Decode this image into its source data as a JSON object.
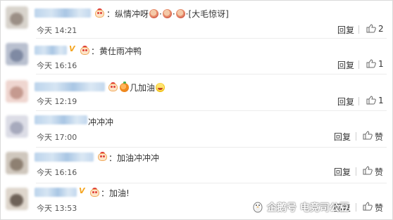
{
  "comments": [
    {
      "content": "：纵情冲呀",
      "emoji_after": [
        "duck",
        "duck",
        "duck"
      ],
      "tail": "[大毛惊讶]",
      "time": "今天 14:21",
      "reply": "回复",
      "like": "2"
    },
    {
      "content": "：黄仕雨冲鸭",
      "vip": "V",
      "time": "今天 16:16",
      "reply": "回复",
      "like": "1"
    },
    {
      "content": "几加油",
      "time": "今天 12:19",
      "reply": "回复",
      "like": "1"
    },
    {
      "content": "冲冲冲",
      "time": "今天 17:00",
      "reply": "回复",
      "like": "赞"
    },
    {
      "content": "：加油冲冲冲",
      "time": "今天 16:16",
      "reply": "回复",
      "like": "赞"
    },
    {
      "content": "：加油!",
      "vip": "V",
      "time": "今天 13:53",
      "reply": "回复",
      "like": "赞"
    }
  ],
  "watermark": {
    "text": "企鹅号 电竞司公豆",
    "icon": "penguin-icon"
  },
  "colors": {
    "vip": "#f5a623",
    "text": "#333333",
    "time": "#555555"
  }
}
